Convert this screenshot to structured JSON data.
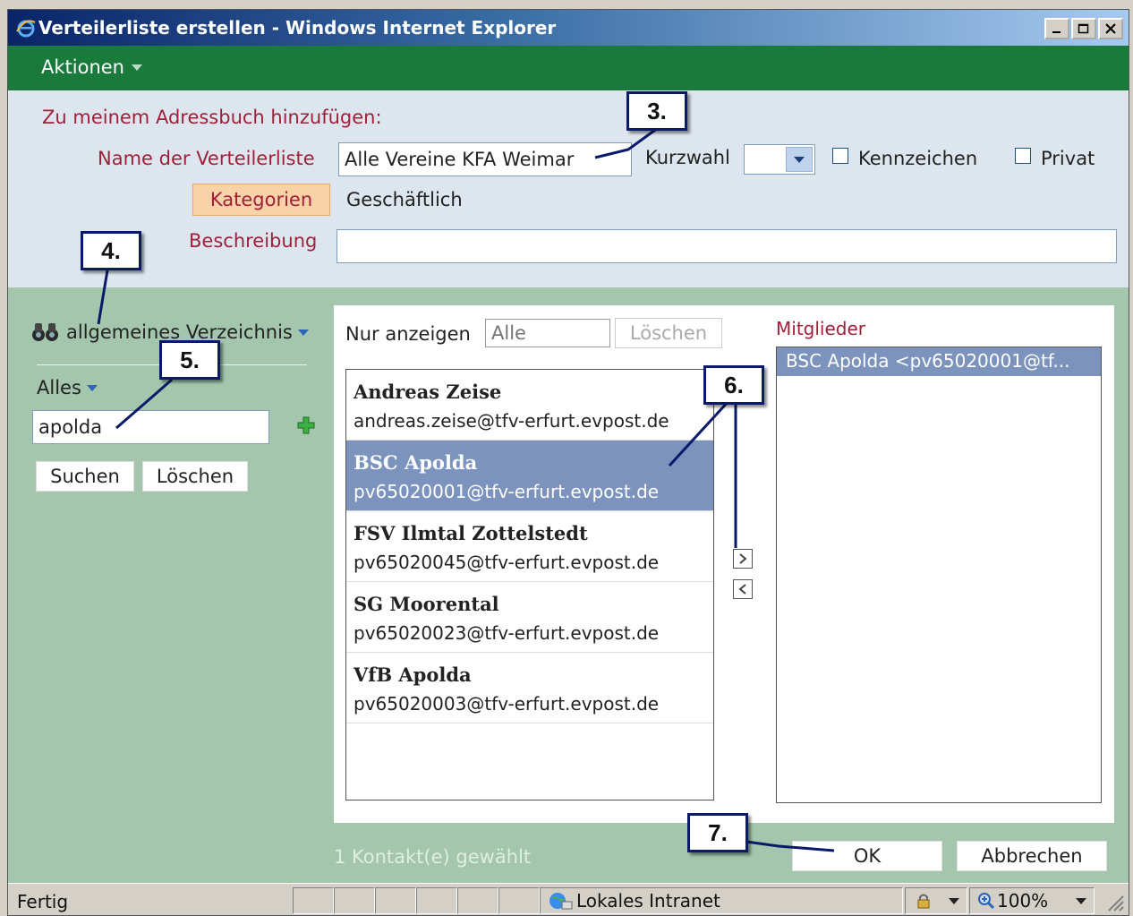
{
  "window": {
    "title": "Verteilerliste erstellen - Windows Internet Explorer"
  },
  "menu": {
    "actions_label": "Aktionen"
  },
  "form": {
    "section_title": "Zu meinem Adressbuch hinzufügen:",
    "name_label": "Name der Verteilerliste",
    "name_value": "Alle Vereine KFA Weimar",
    "kurzwahl_label": "Kurzwahl",
    "kennzeichen_label": "Kennzeichen",
    "privat_label": "Privat",
    "kategorien_button": "Kategorien",
    "kategorie_value": "Geschäftlich",
    "beschreibung_label": "Beschreibung",
    "beschreibung_value": ""
  },
  "directory": {
    "label": "allgemeines Verzeichnis",
    "filter_label": "Alles",
    "search_value": "apolda",
    "search_button": "Suchen",
    "clear_button": "Löschen"
  },
  "results": {
    "only_show_label": "Nur anzeigen",
    "only_show_placeholder": "Alle",
    "clear_button": "Löschen",
    "items": [
      {
        "name": "Andreas Zeise",
        "email": "andreas.zeise@tfv-erfurt.evpost.de",
        "selected": false
      },
      {
        "name": "BSC Apolda",
        "email": "pv65020001@tfv-erfurt.evpost.de",
        "selected": true
      },
      {
        "name": "FSV Ilmtal Zottelstedt",
        "email": "pv65020045@tfv-erfurt.evpost.de",
        "selected": false
      },
      {
        "name": "SG Moorental",
        "email": "pv65020023@tfv-erfurt.evpost.de",
        "selected": false
      },
      {
        "name": "VfB Apolda",
        "email": "pv65020003@tfv-erfurt.evpost.de",
        "selected": false
      }
    ]
  },
  "members": {
    "label": "Mitglieder",
    "items": [
      "BSC Apolda <pv65020001@tf..."
    ]
  },
  "footer": {
    "selection_count": "1 Kontakt(e) gewählt",
    "ok_button": "OK",
    "cancel_button": "Abbrechen"
  },
  "statusbar": {
    "status": "Fertig",
    "zone": "Lokales Intranet",
    "zoom": "100%"
  },
  "callouts": [
    "3.",
    "4.",
    "5.",
    "6.",
    "7."
  ],
  "colors": {
    "title_gradient_start": "#0a246a",
    "green_bar": "#1a7a3c",
    "label_red": "#a0203a",
    "selection_blue": "#7b93bd",
    "panel_green": "#a3c6ac"
  }
}
